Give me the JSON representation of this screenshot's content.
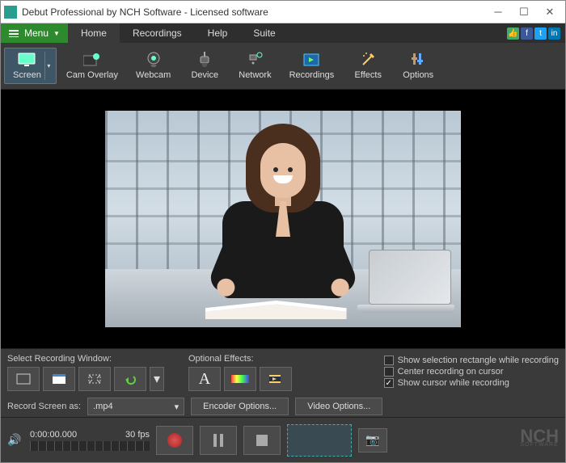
{
  "window": {
    "title": "Debut Professional by NCH Software - Licensed software"
  },
  "menu": {
    "button": "Menu",
    "tabs": [
      "Home",
      "Recordings",
      "Help",
      "Suite"
    ],
    "active_tab": 0
  },
  "toolbar": {
    "items": [
      {
        "label": "Screen",
        "icon": "monitor"
      },
      {
        "label": "Cam Overlay",
        "icon": "cam-overlay"
      },
      {
        "label": "Webcam",
        "icon": "webcam"
      },
      {
        "label": "Device",
        "icon": "device"
      },
      {
        "label": "Network",
        "icon": "network"
      },
      {
        "label": "Recordings",
        "icon": "recordings"
      },
      {
        "label": "Effects",
        "icon": "effects"
      },
      {
        "label": "Options",
        "icon": "options"
      }
    ]
  },
  "panel": {
    "recording_window_label": "Select Recording Window:",
    "optional_effects_label": "Optional Effects:",
    "record_as_label": "Record Screen as:",
    "format_selected": ".mp4",
    "encoder_btn": "Encoder Options...",
    "video_btn": "Video Options...",
    "checks": {
      "show_selection": {
        "label": "Show selection rectangle while recording",
        "checked": false
      },
      "center_cursor": {
        "label": "Center recording on cursor",
        "checked": false
      },
      "show_cursor": {
        "label": "Show cursor while recording",
        "checked": true
      }
    }
  },
  "footer": {
    "timecode": "0:00:00.000",
    "fps": "30 fps"
  },
  "brand": {
    "name": "NCH",
    "sub": "SOFTWARE"
  }
}
